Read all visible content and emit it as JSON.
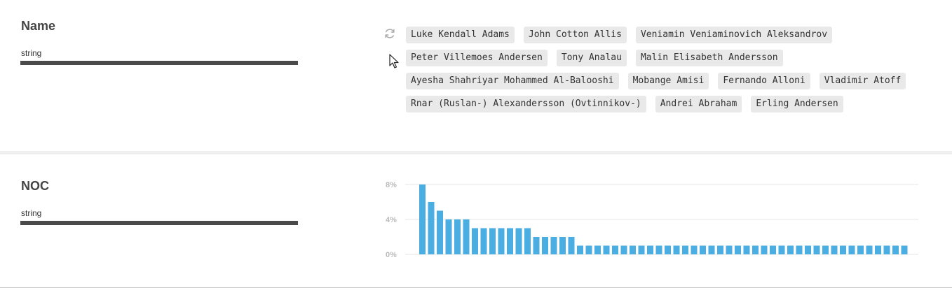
{
  "name_column": {
    "title": "Name",
    "type": "string",
    "sample_values": [
      [
        "Luke Kendall Adams",
        "John Cotton Allis",
        "Veniamin Veniaminovich Aleksandrov"
      ],
      [
        "Peter Villemoes Andersen",
        "Tony Analau",
        "Malin Elisabeth Andersson"
      ],
      [
        "Ayesha Shahriyar Mohammed Al-Balooshi",
        "Mobange Amisi",
        "Fernando Alloni",
        "Vladimir Atoff"
      ],
      [
        "Rnar (Ruslan-) Alexandersson (Ovtinnikov-)",
        "Andrei Abraham",
        "Erling Andersen"
      ]
    ],
    "icons": [
      "refresh-icon",
      "mouse-cursor-icon"
    ]
  },
  "noc_column": {
    "title": "NOC",
    "type": "string"
  },
  "colors": {
    "bar": "#4aaee3",
    "type_bar": "#4a4a4a",
    "tag_bg": "#e9e9e9",
    "gridline": "#e6e6e6",
    "axis_text": "#bbbbbb"
  },
  "chart_data": {
    "type": "bar",
    "yticks": [
      "8%",
      "4%",
      "0%"
    ],
    "ylim": [
      0,
      8
    ],
    "grid": true,
    "values": [
      8,
      6,
      5,
      4,
      4,
      4,
      3,
      3,
      3,
      3,
      3,
      3,
      3,
      2,
      2,
      2,
      2,
      2,
      1,
      1,
      1,
      1,
      1,
      1,
      1,
      1,
      1,
      1,
      1,
      1,
      1,
      1,
      1,
      1,
      1,
      1,
      1,
      1,
      1,
      1,
      1,
      1,
      1,
      1,
      1,
      1,
      1,
      1,
      1,
      1,
      1,
      1,
      1,
      1,
      1,
      1
    ]
  }
}
